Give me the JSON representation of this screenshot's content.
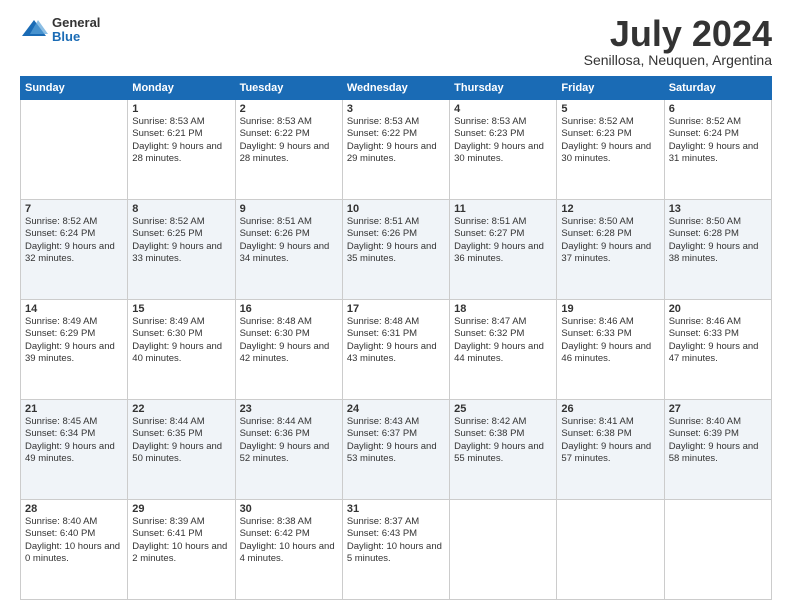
{
  "logo": {
    "general": "General",
    "blue": "Blue"
  },
  "title": {
    "month_year": "July 2024",
    "location": "Senillosa, Neuquen, Argentina"
  },
  "weekdays": [
    "Sunday",
    "Monday",
    "Tuesday",
    "Wednesday",
    "Thursday",
    "Friday",
    "Saturday"
  ],
  "weeks": [
    [
      {
        "day": "",
        "sunrise": "",
        "sunset": "",
        "daylight": ""
      },
      {
        "day": "1",
        "sunrise": "Sunrise: 8:53 AM",
        "sunset": "Sunset: 6:21 PM",
        "daylight": "Daylight: 9 hours and 28 minutes."
      },
      {
        "day": "2",
        "sunrise": "Sunrise: 8:53 AM",
        "sunset": "Sunset: 6:22 PM",
        "daylight": "Daylight: 9 hours and 28 minutes."
      },
      {
        "day": "3",
        "sunrise": "Sunrise: 8:53 AM",
        "sunset": "Sunset: 6:22 PM",
        "daylight": "Daylight: 9 hours and 29 minutes."
      },
      {
        "day": "4",
        "sunrise": "Sunrise: 8:53 AM",
        "sunset": "Sunset: 6:23 PM",
        "daylight": "Daylight: 9 hours and 30 minutes."
      },
      {
        "day": "5",
        "sunrise": "Sunrise: 8:52 AM",
        "sunset": "Sunset: 6:23 PM",
        "daylight": "Daylight: 9 hours and 30 minutes."
      },
      {
        "day": "6",
        "sunrise": "Sunrise: 8:52 AM",
        "sunset": "Sunset: 6:24 PM",
        "daylight": "Daylight: 9 hours and 31 minutes."
      }
    ],
    [
      {
        "day": "7",
        "sunrise": "Sunrise: 8:52 AM",
        "sunset": "Sunset: 6:24 PM",
        "daylight": "Daylight: 9 hours and 32 minutes."
      },
      {
        "day": "8",
        "sunrise": "Sunrise: 8:52 AM",
        "sunset": "Sunset: 6:25 PM",
        "daylight": "Daylight: 9 hours and 33 minutes."
      },
      {
        "day": "9",
        "sunrise": "Sunrise: 8:51 AM",
        "sunset": "Sunset: 6:26 PM",
        "daylight": "Daylight: 9 hours and 34 minutes."
      },
      {
        "day": "10",
        "sunrise": "Sunrise: 8:51 AM",
        "sunset": "Sunset: 6:26 PM",
        "daylight": "Daylight: 9 hours and 35 minutes."
      },
      {
        "day": "11",
        "sunrise": "Sunrise: 8:51 AM",
        "sunset": "Sunset: 6:27 PM",
        "daylight": "Daylight: 9 hours and 36 minutes."
      },
      {
        "day": "12",
        "sunrise": "Sunrise: 8:50 AM",
        "sunset": "Sunset: 6:28 PM",
        "daylight": "Daylight: 9 hours and 37 minutes."
      },
      {
        "day": "13",
        "sunrise": "Sunrise: 8:50 AM",
        "sunset": "Sunset: 6:28 PM",
        "daylight": "Daylight: 9 hours and 38 minutes."
      }
    ],
    [
      {
        "day": "14",
        "sunrise": "Sunrise: 8:49 AM",
        "sunset": "Sunset: 6:29 PM",
        "daylight": "Daylight: 9 hours and 39 minutes."
      },
      {
        "day": "15",
        "sunrise": "Sunrise: 8:49 AM",
        "sunset": "Sunset: 6:30 PM",
        "daylight": "Daylight: 9 hours and 40 minutes."
      },
      {
        "day": "16",
        "sunrise": "Sunrise: 8:48 AM",
        "sunset": "Sunset: 6:30 PM",
        "daylight": "Daylight: 9 hours and 42 minutes."
      },
      {
        "day": "17",
        "sunrise": "Sunrise: 8:48 AM",
        "sunset": "Sunset: 6:31 PM",
        "daylight": "Daylight: 9 hours and 43 minutes."
      },
      {
        "day": "18",
        "sunrise": "Sunrise: 8:47 AM",
        "sunset": "Sunset: 6:32 PM",
        "daylight": "Daylight: 9 hours and 44 minutes."
      },
      {
        "day": "19",
        "sunrise": "Sunrise: 8:46 AM",
        "sunset": "Sunset: 6:33 PM",
        "daylight": "Daylight: 9 hours and 46 minutes."
      },
      {
        "day": "20",
        "sunrise": "Sunrise: 8:46 AM",
        "sunset": "Sunset: 6:33 PM",
        "daylight": "Daylight: 9 hours and 47 minutes."
      }
    ],
    [
      {
        "day": "21",
        "sunrise": "Sunrise: 8:45 AM",
        "sunset": "Sunset: 6:34 PM",
        "daylight": "Daylight: 9 hours and 49 minutes."
      },
      {
        "day": "22",
        "sunrise": "Sunrise: 8:44 AM",
        "sunset": "Sunset: 6:35 PM",
        "daylight": "Daylight: 9 hours and 50 minutes."
      },
      {
        "day": "23",
        "sunrise": "Sunrise: 8:44 AM",
        "sunset": "Sunset: 6:36 PM",
        "daylight": "Daylight: 9 hours and 52 minutes."
      },
      {
        "day": "24",
        "sunrise": "Sunrise: 8:43 AM",
        "sunset": "Sunset: 6:37 PM",
        "daylight": "Daylight: 9 hours and 53 minutes."
      },
      {
        "day": "25",
        "sunrise": "Sunrise: 8:42 AM",
        "sunset": "Sunset: 6:38 PM",
        "daylight": "Daylight: 9 hours and 55 minutes."
      },
      {
        "day": "26",
        "sunrise": "Sunrise: 8:41 AM",
        "sunset": "Sunset: 6:38 PM",
        "daylight": "Daylight: 9 hours and 57 minutes."
      },
      {
        "day": "27",
        "sunrise": "Sunrise: 8:40 AM",
        "sunset": "Sunset: 6:39 PM",
        "daylight": "Daylight: 9 hours and 58 minutes."
      }
    ],
    [
      {
        "day": "28",
        "sunrise": "Sunrise: 8:40 AM",
        "sunset": "Sunset: 6:40 PM",
        "daylight": "Daylight: 10 hours and 0 minutes."
      },
      {
        "day": "29",
        "sunrise": "Sunrise: 8:39 AM",
        "sunset": "Sunset: 6:41 PM",
        "daylight": "Daylight: 10 hours and 2 minutes."
      },
      {
        "day": "30",
        "sunrise": "Sunrise: 8:38 AM",
        "sunset": "Sunset: 6:42 PM",
        "daylight": "Daylight: 10 hours and 4 minutes."
      },
      {
        "day": "31",
        "sunrise": "Sunrise: 8:37 AM",
        "sunset": "Sunset: 6:43 PM",
        "daylight": "Daylight: 10 hours and 5 minutes."
      },
      {
        "day": "",
        "sunrise": "",
        "sunset": "",
        "daylight": ""
      },
      {
        "day": "",
        "sunrise": "",
        "sunset": "",
        "daylight": ""
      },
      {
        "day": "",
        "sunrise": "",
        "sunset": "",
        "daylight": ""
      }
    ]
  ]
}
